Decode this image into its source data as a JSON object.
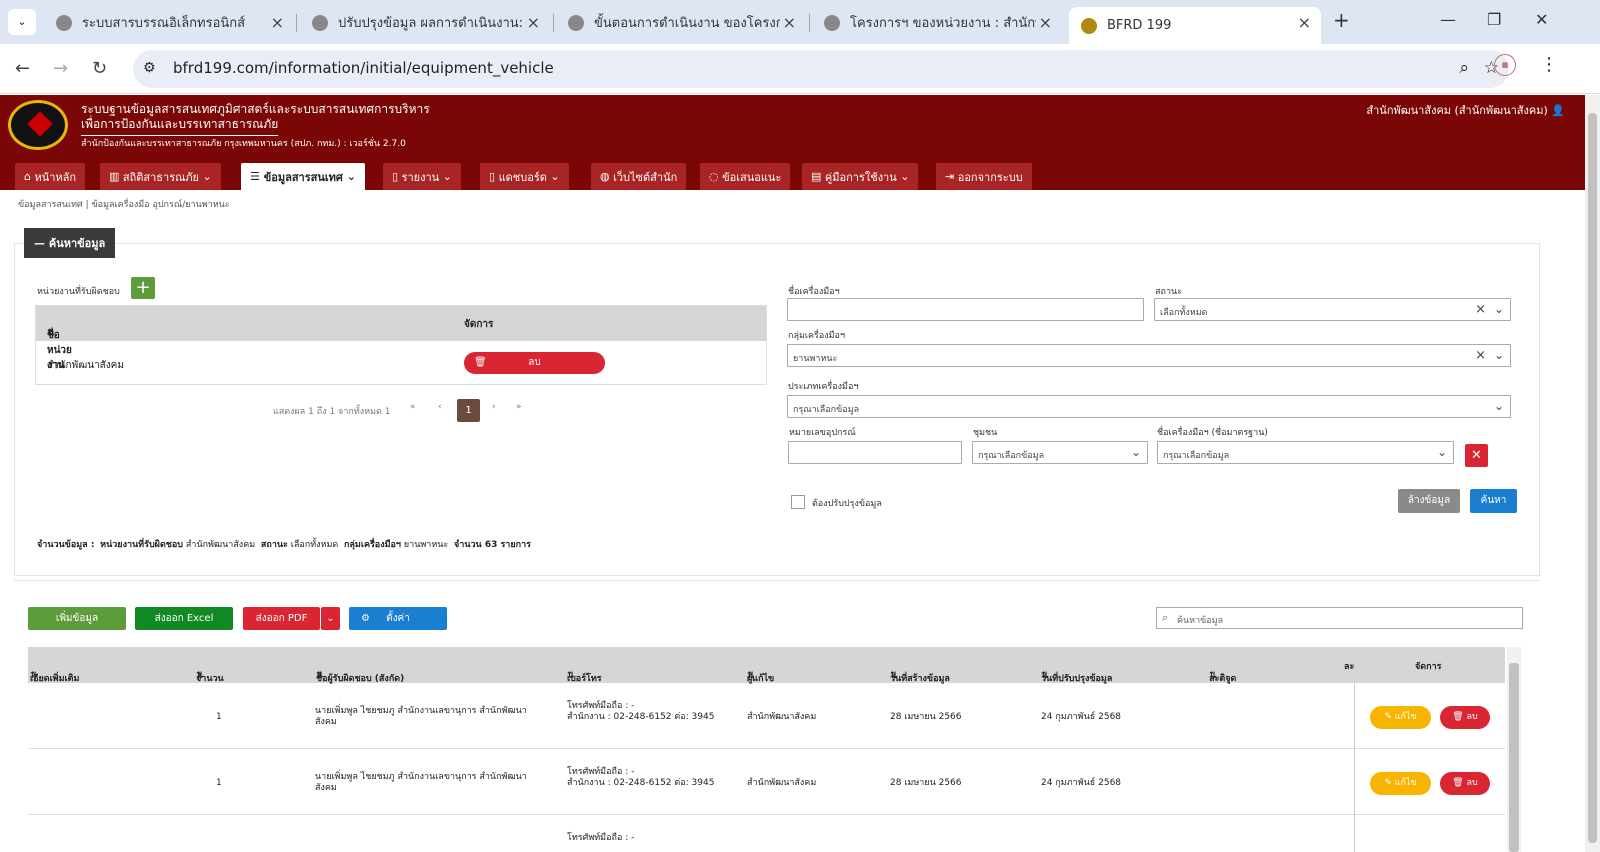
{
  "browser": {
    "tabs": [
      {
        "title": "ระบบสารบรรณอิเล็กทรอนิกส์"
      },
      {
        "title": "ปรับปรุงข้อมูล ผลการดำเนินงาน:"
      },
      {
        "title": "ขั้นตอนการดำเนินงาน ของโครงการ:"
      },
      {
        "title": "โครงการฯ ของหน่วยงาน : สำนักพัฒ"
      },
      {
        "title": "BFRD 199"
      }
    ],
    "url": "bfrd199.com/information/initial/equipment_vehicle"
  },
  "header": {
    "title1": "ระบบฐานข้อมูลสารสนเทศภูมิศาสตร์และระบบสารสนเทศการบริหาร",
    "title2": "เพื่อการป้องกันและบรรเทาสาธารณภัย",
    "subtitle": "สำนักป้องกันและบรรเทาสาธารณภัย กรุงเทพมหานคร (สปภ. กทม.) : เวอร์ชั่น 2.7.0",
    "user": "สำนักพัฒนาสังคม (สำนักพัฒนาสังคม)"
  },
  "menu": [
    "หน้าหลัก",
    "สถิติสาธารณภัย",
    "ข้อมูลสารสนเทศ",
    "รายงาน",
    "แดชบอร์ด",
    "เว็บไซต์สำนัก",
    "ข้อเสนอแนะ",
    "คู่มือการใช้งาน",
    "ออกจากระบบ"
  ],
  "breadcrumb": "ข้อมูลสารสนเทศ | ข้อมูลเครื่องมือ อุปกรณ์/ยานพาหนะ",
  "search": {
    "title": "ค้นหาข้อมูล",
    "unit_label": "หน่วยงานที่รับผิดชอบ",
    "col_name": "ชื่อหน่วยงาน",
    "col_manage": "จัดการ",
    "unit_row": "สำนักพัฒนาสังคม",
    "delete": "ลบ",
    "pager_text": "แสดงผล 1 ถึง 1 จากทั้งหมด 1",
    "page": "1",
    "tool_name_label": "ชื่อเครื่องมือฯ",
    "status_label": "สถานะ",
    "status_value": "เลือกทั้งหมด",
    "group_label": "กลุ่มเครื่องมือฯ",
    "group_value": "ยานพาหนะ",
    "type_label": "ประเภทเครื่องมือฯ",
    "type_value": "กรุณาเลือกข้อมูล",
    "device_no_label": "หมายเลขอุปกรณ์",
    "community_label": "ชุมชน",
    "community_value": "กรุณาเลือกข้อมูล",
    "std_name_label": "ชื่อเครื่องมือฯ (ชื่อมาตรฐาน)",
    "std_name_value": "กรุณาเลือกข้อมูล",
    "update_check": "ต้องปรับปรุงข้อมูล",
    "clear": "ล้างข้อมูล",
    "search": "ค้นหา"
  },
  "summary": {
    "prefix": "จำนวนข้อมูล :",
    "k1": "หน่วยงานที่รับผิดชอบ",
    "v1": "สำนักพัฒนาสังคม",
    "k2": "สถานะ",
    "v2": "เลือกทั้งหมด",
    "k3": "กลุ่มเครื่องมือฯ",
    "v3": "ยานพาหนะ",
    "k4": "จำนวน 63 รายการ"
  },
  "toolbar": {
    "add": "เพิ่มข้อมูล",
    "excel": "ส่งออก Excel",
    "pdf": "ส่งออก PDF",
    "settings": "ตั้งค่า",
    "search_placeholder": "ค้นหาข้อมูล"
  },
  "table": {
    "headers": [
      "เอียดเพิ่มเติม",
      "จำนวน",
      "ชื่อผู้รับผิดชอบ (สังกัด)",
      "เบอร์โทร",
      "ผู้แก้ไข",
      "วันที่สร้างข้อมูล",
      "วันที่ปรับปรุงข้อมูล",
      "ละติจูด",
      "ละ",
      "จัดการ"
    ],
    "rows": [
      {
        "qty": "1",
        "owner1": "นายเพิ่มพูล ไชยชมภู สำนักงานเลขานุการ สำนักพัฒนา",
        "owner2": "สังคม",
        "phone1": "โทรศัพท์มือถือ : -",
        "phone2": "สำนักงาน : 02-248-6152 ต่อ: 3945",
        "editor": "สำนักพัฒนาสังคม",
        "created": "28 เมษายน 2566",
        "updated": "24 กุมภาพันธ์ 2568",
        "edit": "แก้ไข",
        "del": "ลบ"
      },
      {
        "qty": "1",
        "owner1": "นายเพิ่มพูล ไชยชมภู สำนักงานเลขานุการ สำนักพัฒนา",
        "owner2": "สังคม",
        "phone1": "โทรศัพท์มือถือ : -",
        "phone2": "สำนักงาน : 02-248-6152 ต่อ: 3945",
        "editor": "สำนักพัฒนาสังคม",
        "created": "28 เมษายน 2566",
        "updated": "24 กุมภาพันธ์ 2568",
        "edit": "แก้ไข",
        "del": "ลบ"
      }
    ],
    "partial_phone": "โทรศัพท์มือถือ : -"
  },
  "colors": {
    "header": "#7b0606",
    "menu": "#a92525",
    "green": "#5d9c3a",
    "red": "#d92632",
    "blue": "#1a7fd1",
    "yellow": "#f7b500"
  }
}
